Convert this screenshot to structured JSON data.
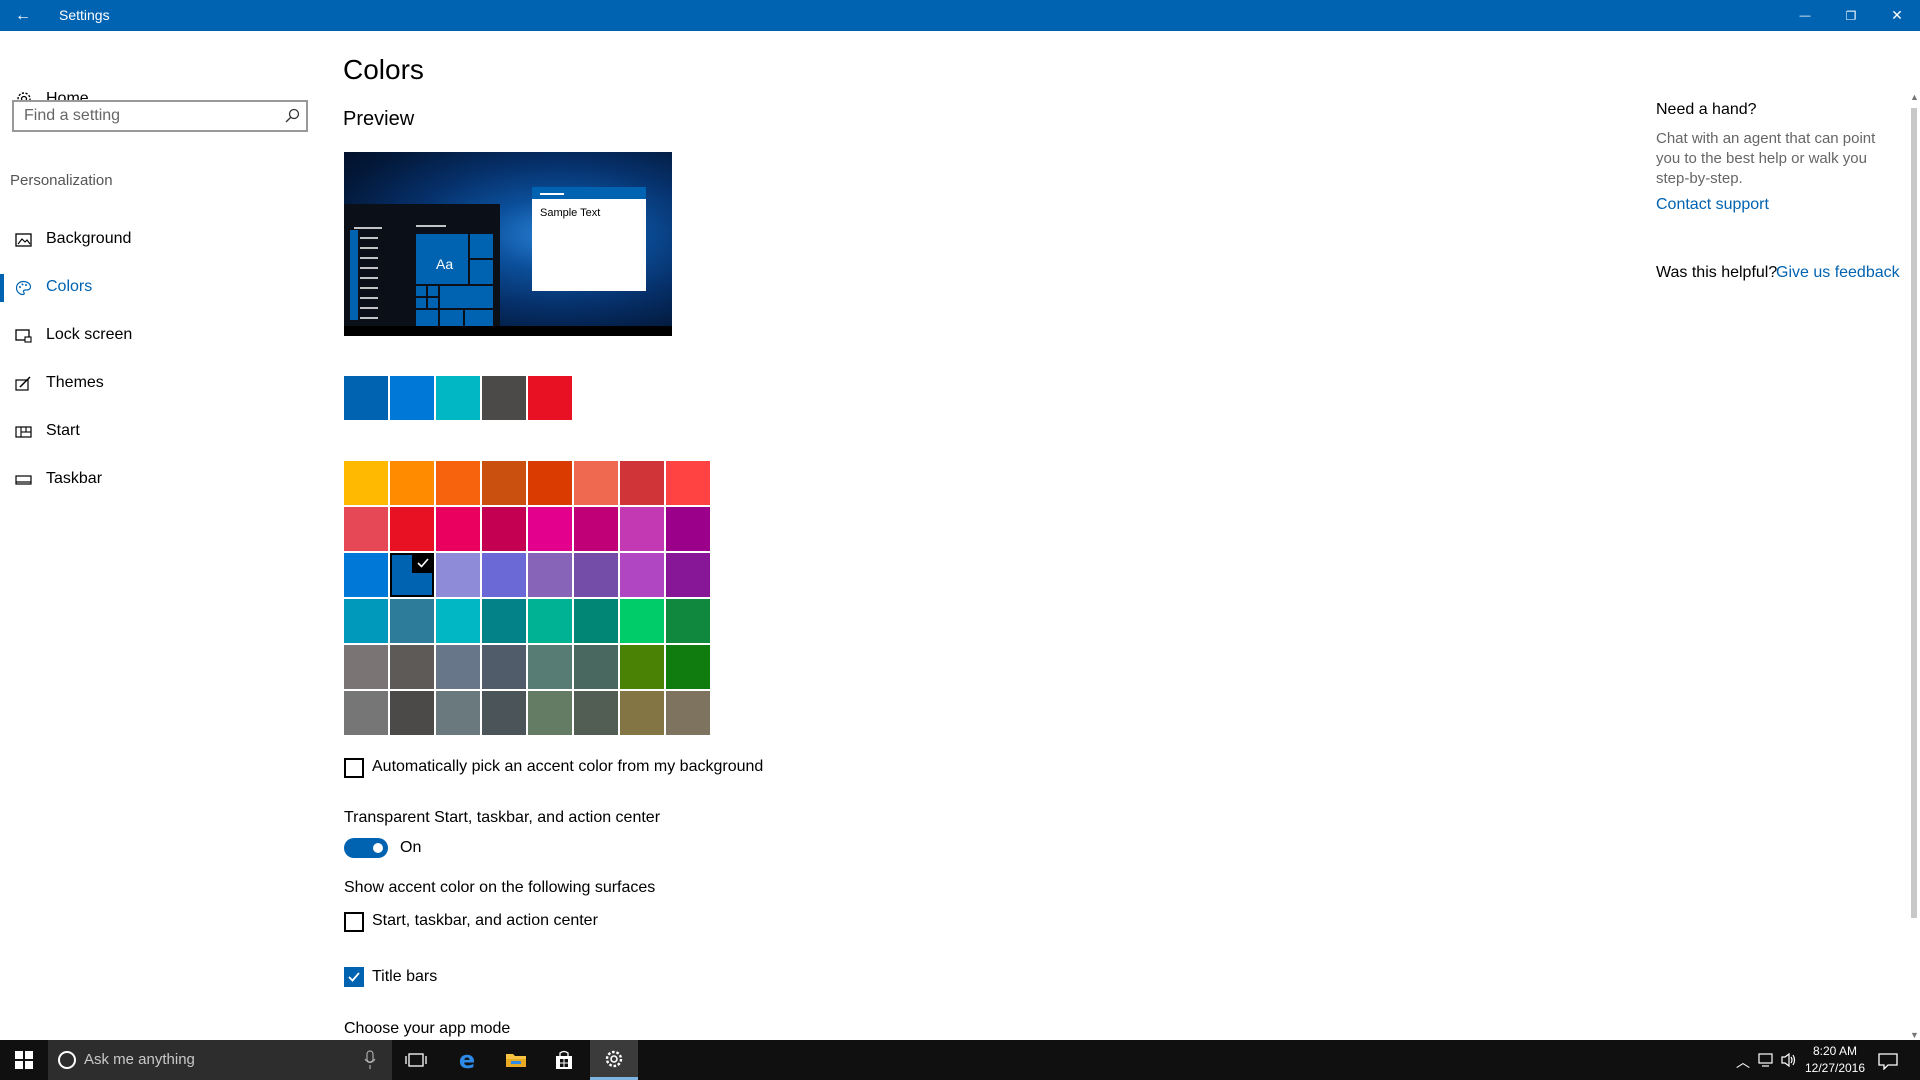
{
  "window": {
    "title": "Settings",
    "back_glyph": "←",
    "minimize_glyph": "—",
    "restore_glyph": "❐",
    "close_glyph": "✕"
  },
  "sidebar": {
    "home_label": "Home",
    "search_placeholder": "Find a setting",
    "section": "Personalization",
    "items": [
      {
        "label": "Background",
        "icon": "picture-icon"
      },
      {
        "label": "Colors",
        "icon": "palette-icon",
        "active": true
      },
      {
        "label": "Lock screen",
        "icon": "lock-screen-icon"
      },
      {
        "label": "Themes",
        "icon": "brush-icon"
      },
      {
        "label": "Start",
        "icon": "start-tiles-icon"
      },
      {
        "label": "Taskbar",
        "icon": "taskbar-icon"
      }
    ]
  },
  "main": {
    "title": "Colors",
    "preview_label": "Preview",
    "preview_sample_text": "Sample Text",
    "preview_tile_text": "Aa",
    "recent_colors": [
      "#0063b1",
      "#0078d7",
      "#00b7c3",
      "#4c4a48",
      "#e81123"
    ],
    "accent_grid": [
      [
        "#ffb900",
        "#ff8c00",
        "#f7630c",
        "#ca5010",
        "#da3b01",
        "#ef6950",
        "#d13438",
        "#ff4343"
      ],
      [
        "#e74856",
        "#e81123",
        "#ea005e",
        "#c30052",
        "#e3008c",
        "#bf0077",
        "#c239b3",
        "#9a0089"
      ],
      [
        "#0078d7",
        "#0063b1",
        "#8e8cd8",
        "#6b69d6",
        "#8764b8",
        "#744da9",
        "#b146c2",
        "#881798"
      ],
      [
        "#0099bc",
        "#2d7d9a",
        "#00b7c3",
        "#038387",
        "#00b294",
        "#018574",
        "#00cc6a",
        "#10893e"
      ],
      [
        "#7a7574",
        "#5d5a58",
        "#68768a",
        "#515c6b",
        "#567c73",
        "#486860",
        "#498205",
        "#107c10"
      ],
      [
        "#767676",
        "#4c4a48",
        "#69797e",
        "#4a5459",
        "#647c64",
        "#525e54",
        "#847545",
        "#7e735f"
      ]
    ],
    "selected_color": "#0063b1",
    "auto_pick_label": "Automatically pick an accent color from my background",
    "auto_pick_checked": false,
    "transparency_label": "Transparent Start, taskbar, and action center",
    "transparency_state": "On",
    "transparency_on": true,
    "show_accent_label": "Show accent color on the following surfaces",
    "surface_start_label": "Start, taskbar, and action center",
    "surface_start_checked": false,
    "surface_title_label": "Title bars",
    "surface_title_checked": true,
    "app_mode_label": "Choose your app mode"
  },
  "help": {
    "title": "Need a hand?",
    "body": "Chat with an agent that can point you to the best help or walk you step-by-step.",
    "contact": "Contact support",
    "helpful_question": "Was this helpful?",
    "feedback": "Give us feedback"
  },
  "taskbar": {
    "search_placeholder": "Ask me anything",
    "apps": [
      "task-view-icon",
      "edge-icon",
      "file-explorer-icon",
      "store-icon",
      "settings-icon"
    ],
    "active_app": "settings-icon",
    "time": "8:20 AM",
    "date": "12/27/2016",
    "colors": {
      "bar": "#101010",
      "accent": "#0063b1"
    }
  }
}
